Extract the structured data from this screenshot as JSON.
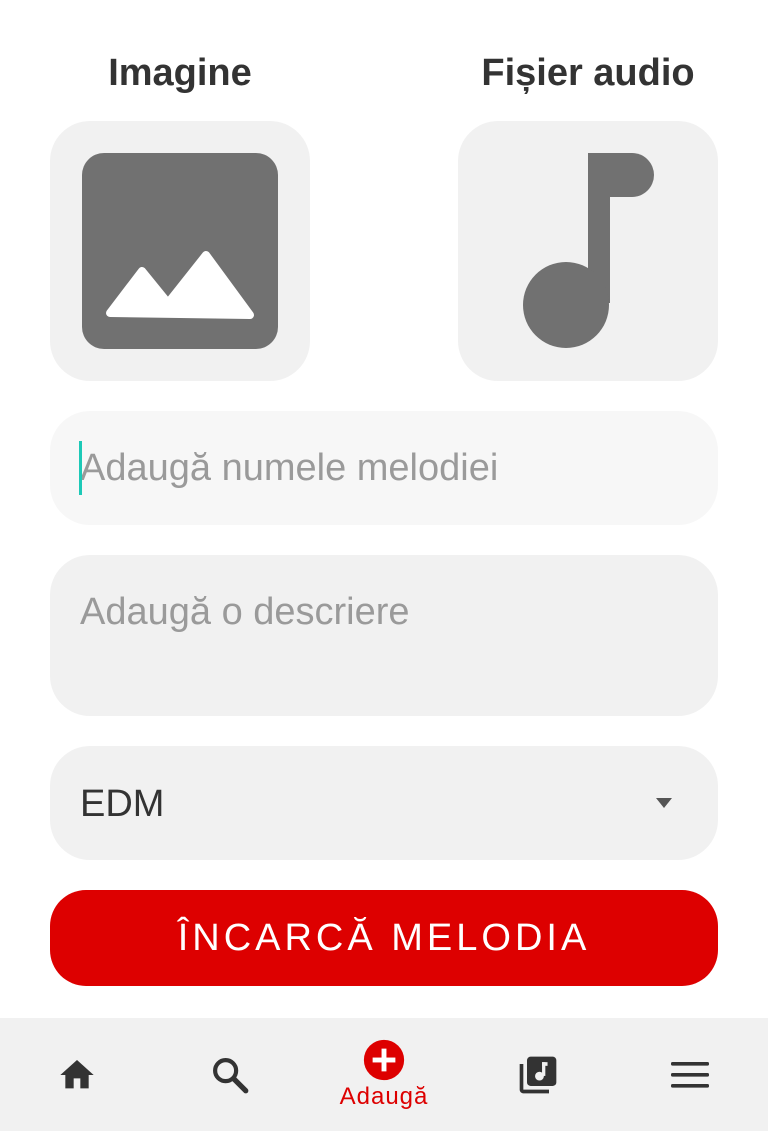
{
  "pickers": {
    "image_label": "Imagine",
    "audio_label": "Fișier audio"
  },
  "form": {
    "song_name_placeholder": "Adaugă numele melodiei",
    "song_name_value": "",
    "description_placeholder": "Adaugă o descriere",
    "description_value": "",
    "genre_selected": "EDM"
  },
  "upload_button": {
    "label": "ÎNCARCĂ MELODIA"
  },
  "bottom_nav": {
    "items": [
      {
        "icon": "home-icon",
        "label": ""
      },
      {
        "icon": "search-icon",
        "label": ""
      },
      {
        "icon": "add-circle-icon",
        "label": "Adaugă",
        "active": true
      },
      {
        "icon": "library-music-icon",
        "label": ""
      },
      {
        "icon": "menu-icon",
        "label": ""
      }
    ]
  },
  "colors": {
    "accent": "#dd0000",
    "field_bg": "#f1f1f1",
    "icon_gray": "#717171",
    "caret": "#1dc9b7"
  }
}
